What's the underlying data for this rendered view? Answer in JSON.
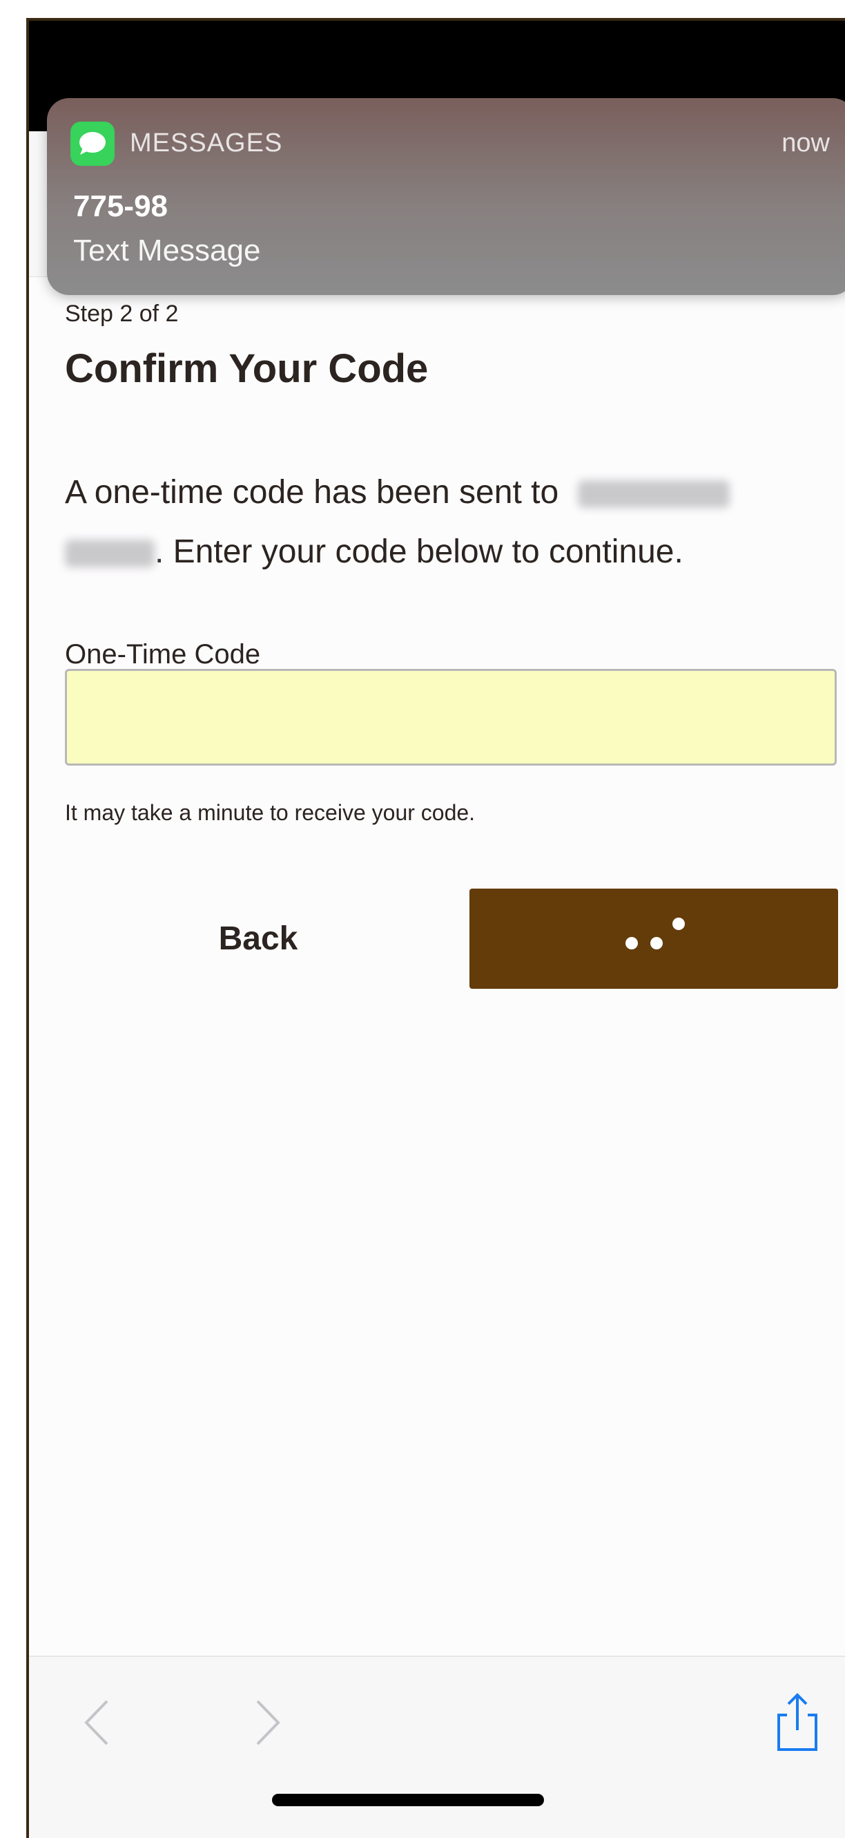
{
  "notification": {
    "app_name": "MESSAGES",
    "time": "now",
    "sender": "775-98",
    "body": "Text Message",
    "icon": "messages-app-icon",
    "accent": "#37d35a"
  },
  "page": {
    "step": "Step 2 of 2",
    "title": "Confirm Your Code",
    "description_prefix": "A one-time code has been sent to",
    "description_suffix": ". Enter your code below to continue.",
    "field_label": "One-Time Code",
    "field_value": "",
    "hint": "It may take a minute to receive your code.",
    "back_label": "Back",
    "continue_state": "loading",
    "brand_color": "#633c0a",
    "input_bg": "#fafcc0"
  },
  "toolbar": {
    "back_icon": "chevron-left-icon",
    "forward_icon": "chevron-right-icon",
    "share_icon": "share-icon",
    "accent": "#1a7cf0"
  }
}
